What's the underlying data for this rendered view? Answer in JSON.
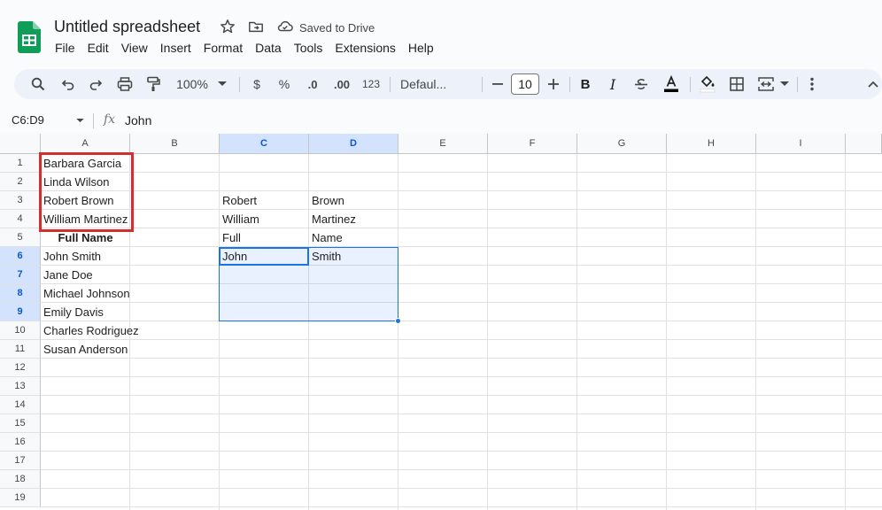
{
  "document": {
    "title": "Untitled spreadsheet",
    "saved_status": "Saved to Drive"
  },
  "menu": [
    "File",
    "Edit",
    "View",
    "Insert",
    "Format",
    "Data",
    "Tools",
    "Extensions",
    "Help"
  ],
  "toolbar": {
    "zoom": "100%",
    "currency": "$",
    "percent": "%",
    "decrease_decimal": ".0",
    "increase_decimal": ".00",
    "number_format": "123",
    "font": "Defaul...",
    "font_size": "10",
    "bold": "B",
    "italic": "I"
  },
  "formula_bar": {
    "range": "C6:D9",
    "fx": "fx",
    "value": "John"
  },
  "grid": {
    "columns": [
      "A",
      "B",
      "C",
      "D",
      "E",
      "F",
      "G",
      "H",
      "I"
    ],
    "rows": [
      "1",
      "2",
      "3",
      "4",
      "5",
      "6",
      "7",
      "8",
      "9",
      "10",
      "11",
      "12",
      "13",
      "14",
      "15",
      "16",
      "17",
      "18",
      "19"
    ],
    "col_a": [
      "Barbara Garcia",
      "Linda Wilson",
      "Robert Brown",
      "William Martinez",
      "Full Name",
      "John Smith",
      "Jane Doe",
      "Michael Johnson",
      "Emily Davis",
      "Charles Rodriguez",
      "Susan Anderson"
    ],
    "col_c": [
      "Robert",
      "William",
      "Full",
      "John"
    ],
    "col_d": [
      "Brown",
      "Martinez",
      "Name",
      "Smith"
    ]
  },
  "colors": {
    "accent": "#1a73e8",
    "highlight": "#d32f2f",
    "sheets_green": "#0f9d58"
  }
}
